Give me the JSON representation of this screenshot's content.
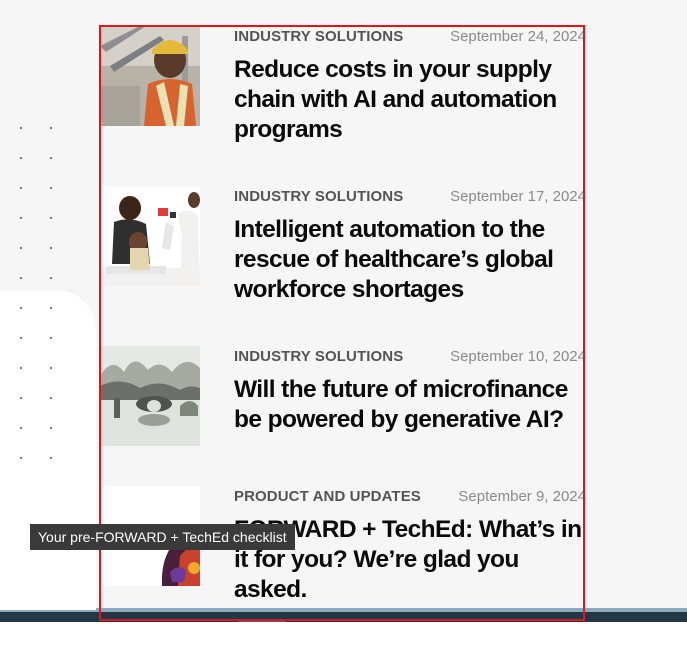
{
  "articles": [
    {
      "category": "INDUSTRY SOLUTIONS",
      "date": "September 24, 2024",
      "title": "Reduce costs in your supply chain with AI and automation programs",
      "image_icon": "worker-hardhat-photo"
    },
    {
      "category": "INDUSTRY SOLUTIONS",
      "date": "September 17, 2024",
      "title": "Intelligent automation to the rescue of healthcare’s global workforce shortages",
      "image_icon": "doctor-patient-photo"
    },
    {
      "category": "INDUSTRY SOLUTIONS",
      "date": "September 10, 2024",
      "title": "Will the future of microfinance be powered by generative AI?",
      "image_icon": "misty-river-bridge-photo"
    },
    {
      "category": "PRODUCT AND UPDATES",
      "date": "September 9, 2024",
      "title": "FORWARD + TechEd: What’s in it for you? We’re glad you asked.",
      "image_icon": "abstract-shapes-photo"
    }
  ],
  "tooltip": {
    "text": "Your pre-FORWARD + TechEd checklist"
  },
  "colors": {
    "highlight_border": "#e0161e",
    "footer_band": "#213743",
    "footer_accent": "#8ea9bb",
    "category_text": "#545454",
    "date_text": "#8a8a8a"
  }
}
